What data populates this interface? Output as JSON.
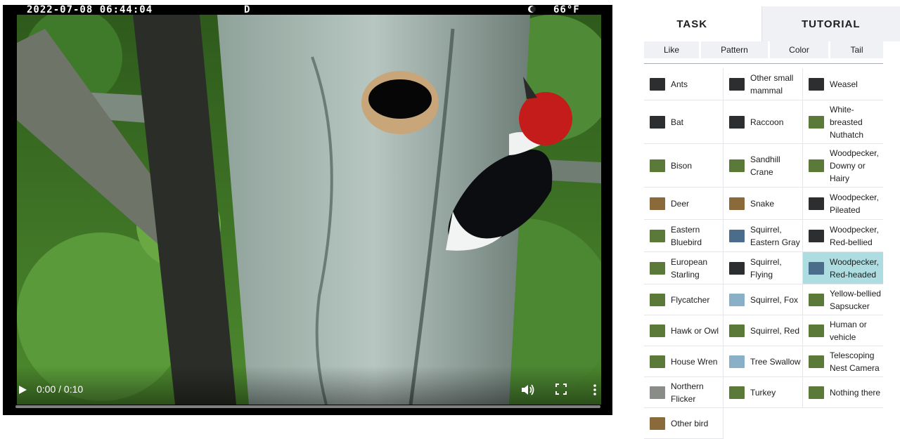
{
  "video": {
    "osd": {
      "timestamp": "2022-07-08 06:44:04",
      "mode": "D",
      "temperature": "66°F"
    },
    "time_display": "0:00 / 0:10",
    "progress": 0.0
  },
  "panel": {
    "tabs": [
      {
        "label": "TASK",
        "active": true
      },
      {
        "label": "TUTORIAL",
        "active": false
      }
    ],
    "filters": [
      "Like",
      "Pattern",
      "Color",
      "Tail"
    ],
    "choices": [
      {
        "label": "Ants",
        "thumb": "dark"
      },
      {
        "label": "Other small mammal",
        "thumb": "dark"
      },
      {
        "label": "Weasel",
        "thumb": "dark"
      },
      {
        "label": "Bat",
        "thumb": "dark"
      },
      {
        "label": "Raccoon",
        "thumb": "dark"
      },
      {
        "label": "White-breasted Nuthatch",
        "thumb": "green"
      },
      {
        "label": "Bison",
        "thumb": "green"
      },
      {
        "label": "Sandhill Crane",
        "thumb": "green"
      },
      {
        "label": "Woodpecker, Downy or Hairy",
        "thumb": "green"
      },
      {
        "label": "Deer",
        "thumb": "brown"
      },
      {
        "label": "Snake",
        "thumb": "brown"
      },
      {
        "label": "Woodpecker, Pileated",
        "thumb": "dark"
      },
      {
        "label": "Eastern Bluebird",
        "thumb": "green"
      },
      {
        "label": "Squirrel, Eastern Gray",
        "thumb": "blue"
      },
      {
        "label": "Woodpecker, Red-bellied",
        "thumb": "dark"
      },
      {
        "label": "European Starling",
        "thumb": "green"
      },
      {
        "label": "Squirrel, Flying",
        "thumb": "dark"
      },
      {
        "label": "Woodpecker, Red-headed",
        "thumb": "blue",
        "selected": true
      },
      {
        "label": "Flycatcher",
        "thumb": "green"
      },
      {
        "label": "Squirrel, Fox",
        "thumb": "sky"
      },
      {
        "label": "Yellow-bellied Sapsucker",
        "thumb": "green"
      },
      {
        "label": "Hawk or Owl",
        "thumb": "green"
      },
      {
        "label": "Squirrel, Red",
        "thumb": "green"
      },
      {
        "label": "Human or vehicle",
        "thumb": "green"
      },
      {
        "label": "House Wren",
        "thumb": "green"
      },
      {
        "label": "Tree Swallow",
        "thumb": "sky"
      },
      {
        "label": "Telescoping Nest Camera",
        "thumb": "green"
      },
      {
        "label": "Northern Flicker",
        "thumb": "grey"
      },
      {
        "label": "Turkey",
        "thumb": "green"
      },
      {
        "label": "Nothing there",
        "thumb": "green"
      },
      {
        "label": "Other bird",
        "thumb": "brown"
      }
    ],
    "colors": {
      "selected": "#addde1",
      "tab_active": "#ffffff",
      "tab_inactive": "#eff1f4"
    }
  }
}
